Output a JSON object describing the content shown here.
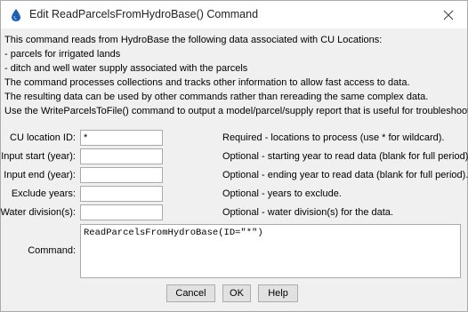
{
  "window": {
    "title": "Edit ReadParcelsFromHydroBase() Command",
    "close_glyph": "✕",
    "title_icon": "app-drop-icon",
    "accent_color": "#1e5fb0"
  },
  "info_lines": [
    "This command reads from HydroBase the following data associated with CU Locations:",
    "   - parcels for irrigated lands",
    "   - ditch and well water supply associated with the parcels",
    "The command processes collections and tracks other information to allow fast access to data.",
    "The resulting data can be used by other commands rather than rereading the same complex data.",
    "Use the WriteParcelsToFile() command to output a model/parcel/supply report that is useful for troubleshooting."
  ],
  "fields": {
    "cu_location_id": {
      "label": "CU location ID:",
      "value": "*",
      "hint": "Required - locations to process (use * for wildcard)."
    },
    "input_start": {
      "label": "Input start (year):",
      "value": "",
      "hint": "Optional - starting year to read data (blank for full period)."
    },
    "input_end": {
      "label": "Input end (year):",
      "value": "",
      "hint": "Optional - ending year to read data (blank for full period)."
    },
    "exclude_years": {
      "label": "Exclude years:",
      "value": "",
      "hint": "Optional - years to exclude."
    },
    "water_division": {
      "label": "Water division(s):",
      "value": "",
      "hint": "Optional - water division(s) for the data."
    }
  },
  "command": {
    "label": "Command:",
    "text": "ReadParcelsFromHydroBase(ID=\"*\")"
  },
  "buttons": {
    "cancel": "Cancel",
    "ok": "OK",
    "help": "Help"
  }
}
